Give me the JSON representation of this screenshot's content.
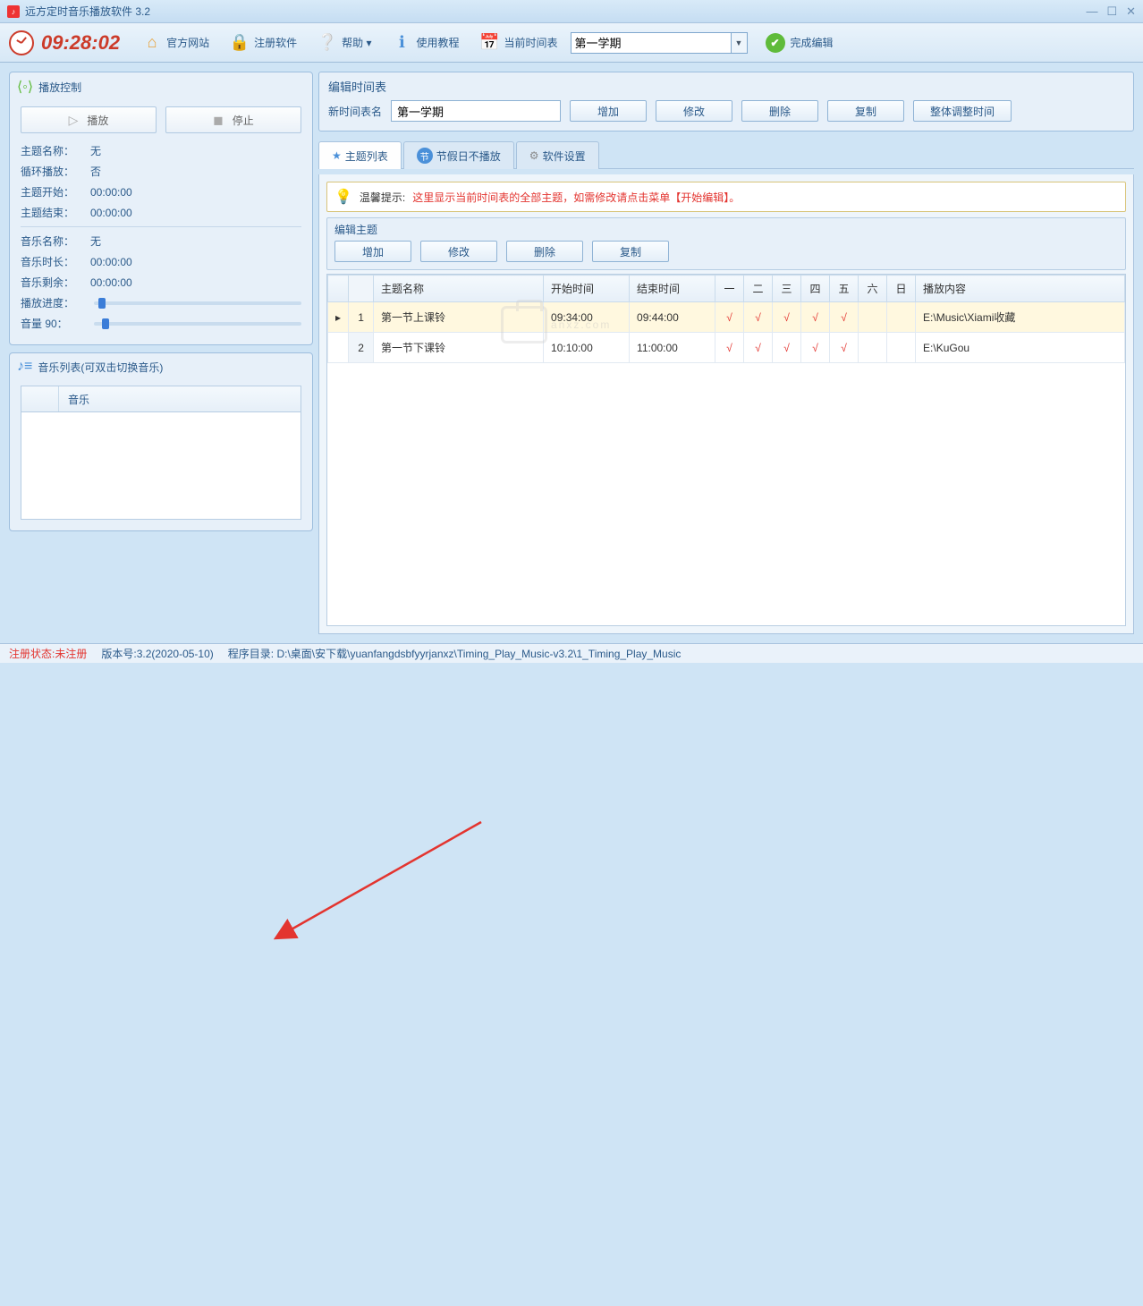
{
  "window": {
    "title": "远方定时音乐播放软件 3.2"
  },
  "toolbar": {
    "time": "09:28:02",
    "site": "官方网站",
    "register": "注册软件",
    "help": "帮助 ▾",
    "tutorial": "使用教程",
    "schedule_label": "当前时间表",
    "schedule_value": "第一学期",
    "finish": "完成编辑"
  },
  "playctrl": {
    "title": "播放控制",
    "play": "播放",
    "stop": "停止",
    "rows": {
      "theme_name_k": "主题名称：",
      "theme_name_v": "无",
      "loop_k": "循环播放：",
      "loop_v": "否",
      "start_k": "主题开始：",
      "start_v": "00:00:00",
      "end_k": "主题结束：",
      "end_v": "00:00:00",
      "music_name_k": "音乐名称：",
      "music_name_v": "无",
      "duration_k": "音乐时长：",
      "duration_v": "00:00:00",
      "remain_k": "音乐剩余：",
      "remain_v": "00:00:00",
      "progress_k": "播放进度：",
      "volume_k": "音量 90："
    },
    "progress_pct": 2,
    "volume_pct": 4
  },
  "musiclist": {
    "title": "音乐列表(可双击切换音乐)",
    "col_music": "音乐"
  },
  "editSchedule": {
    "title": "编辑时间表",
    "name_label": "新时间表名",
    "name_value": "第一学期",
    "add": "增加",
    "modify": "修改",
    "delete": "删除",
    "copy": "复制",
    "adjust": "整体调整时间"
  },
  "tabs": {
    "themes": "主题列表",
    "holiday": "节假日不播放",
    "settings": "软件设置"
  },
  "hint": {
    "prefix": "温馨提示:",
    "text": "这里显示当前时间表的全部主题，如需修改请点击菜单【开始编辑】。"
  },
  "editTheme": {
    "title": "编辑主题",
    "add": "增加",
    "modify": "修改",
    "delete": "删除",
    "copy": "复制"
  },
  "grid": {
    "headers": {
      "name": "主题名称",
      "start": "开始时间",
      "end": "结束时间",
      "d1": "一",
      "d2": "二",
      "d3": "三",
      "d4": "四",
      "d5": "五",
      "d6": "六",
      "d7": "日",
      "content": "播放内容"
    },
    "rows": [
      {
        "num": "1",
        "name": "第一节上课铃",
        "start": "09:34:00",
        "end": "09:44:00",
        "d": [
          "√",
          "√",
          "√",
          "√",
          "√",
          "",
          ""
        ],
        "content": "E:\\Music\\Xiami收藏"
      },
      {
        "num": "2",
        "name": "第一节下课铃",
        "start": "10:10:00",
        "end": "11:00:00",
        "d": [
          "√",
          "√",
          "√",
          "√",
          "√",
          "",
          ""
        ],
        "content": "E:\\KuGou"
      }
    ]
  },
  "status": {
    "reg_label": "注册状态:",
    "reg_value": "未注册",
    "ver_label": "版本号:",
    "ver_value": "3.2(2020-05-10)",
    "dir_label": "程序目录:",
    "dir_value": "D:\\桌面\\安下载\\yuanfangdsbfyyrjanxz\\Timing_Play_Music-v3.2\\1_Timing_Play_Music"
  },
  "watermark": "anxz.com"
}
